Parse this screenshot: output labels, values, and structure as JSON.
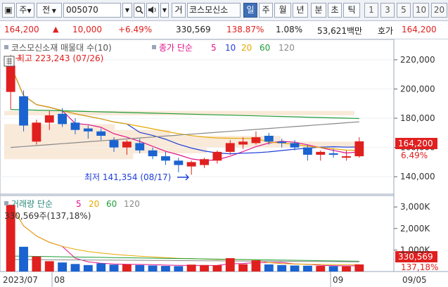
{
  "toolbar": {
    "type_label": "주",
    "mode_label": "전",
    "stock_code": "005070",
    "search_icon": "search-icon",
    "speaker_icon": "speaker-icon",
    "market_button": "거",
    "stock_name": "코스모신소",
    "periods": [
      "일",
      "주",
      "월",
      "년",
      "분",
      "초",
      "틱"
    ],
    "active_period": "일",
    "intervals": [
      "1",
      "3",
      "5",
      "10",
      "20"
    ]
  },
  "quote": {
    "price": "164,200",
    "arrow": "▲",
    "change": "10,000",
    "change_pct": "+6.49%",
    "volume": "330,569",
    "volume_ratio": "138.87%",
    "turnover": "1.08%",
    "amount": "53,621백만",
    "ask_label": "호가",
    "ask_price": "164,200"
  },
  "price_chart": {
    "title": "코스모신소재 매물대 수(10)",
    "ma_label": "종가 단순",
    "ma_periods": [
      "5",
      "10",
      "20",
      "60",
      "120"
    ],
    "high_label": "최고 223,243 (07/26)",
    "low_label": "최저 141,354 (08/17)",
    "y_ticks": [
      "220,000",
      "200,000",
      "180,000",
      "160,000",
      "140,000"
    ],
    "last_price": "164,200",
    "last_pct": "6.49%"
  },
  "volume_chart": {
    "title": "거래량 단순",
    "ma_periods": [
      "5",
      "20",
      "60",
      "120"
    ],
    "last_label": "330,569주(137,18%)",
    "y_ticks": [
      "3,000K",
      "2,000K",
      "1,000K"
    ],
    "last_volume": "330,569",
    "last_pct": "137,18%"
  },
  "x_axis": {
    "labels": [
      "2023/07",
      "08",
      "09",
      "09/05"
    ]
  },
  "colors": {
    "up": "#e0201f",
    "down": "#1a63d0",
    "ma5": "#e0138c",
    "ma10": "#1f3fd8",
    "ma20": "#e6a800",
    "ma60": "#1f9d3a",
    "ma120": "#888888"
  },
  "chart_data": {
    "type": "candlestick",
    "dates_first": "2023/07",
    "dates_last": "09/05",
    "candles": [
      {
        "o": 198000,
        "h": 223243,
        "l": 186000,
        "c": 216000
      },
      {
        "o": 195000,
        "h": 199000,
        "l": 171000,
        "c": 175000
      },
      {
        "o": 164000,
        "h": 179000,
        "l": 162000,
        "c": 177000
      },
      {
        "o": 177000,
        "h": 185000,
        "l": 172000,
        "c": 182000
      },
      {
        "o": 183000,
        "h": 187000,
        "l": 174000,
        "c": 176000
      },
      {
        "o": 177000,
        "h": 180000,
        "l": 169000,
        "c": 172000
      },
      {
        "o": 173000,
        "h": 175000,
        "l": 166000,
        "c": 171000
      },
      {
        "o": 171000,
        "h": 173000,
        "l": 165000,
        "c": 168000
      },
      {
        "o": 165000,
        "h": 167000,
        "l": 157000,
        "c": 160000
      },
      {
        "o": 160000,
        "h": 165000,
        "l": 155000,
        "c": 164000
      },
      {
        "o": 163000,
        "h": 166000,
        "l": 156000,
        "c": 158000
      },
      {
        "o": 158000,
        "h": 160000,
        "l": 152000,
        "c": 154000
      },
      {
        "o": 154000,
        "h": 157000,
        "l": 148000,
        "c": 151000
      },
      {
        "o": 151000,
        "h": 153000,
        "l": 143000,
        "c": 148000
      },
      {
        "o": 147000,
        "h": 151000,
        "l": 141354,
        "c": 150000
      },
      {
        "o": 148000,
        "h": 153000,
        "l": 146000,
        "c": 152000
      },
      {
        "o": 151000,
        "h": 158000,
        "l": 149000,
        "c": 157000
      },
      {
        "o": 157000,
        "h": 165000,
        "l": 155000,
        "c": 163000
      },
      {
        "o": 162000,
        "h": 167000,
        "l": 159000,
        "c": 164000
      },
      {
        "o": 163000,
        "h": 171000,
        "l": 162000,
        "c": 167000
      },
      {
        "o": 168000,
        "h": 170000,
        "l": 162000,
        "c": 164000
      },
      {
        "o": 164000,
        "h": 166000,
        "l": 160000,
        "c": 163000
      },
      {
        "o": 163000,
        "h": 165000,
        "l": 158000,
        "c": 160000
      },
      {
        "o": 160000,
        "h": 162000,
        "l": 151000,
        "c": 155000
      },
      {
        "o": 155000,
        "h": 158000,
        "l": 151000,
        "c": 157000
      },
      {
        "o": 156000,
        "h": 159000,
        "l": 153000,
        "c": 155000
      },
      {
        "o": 153000,
        "h": 158000,
        "l": 151000,
        "c": 154000
      },
      {
        "o": 154000,
        "h": 167000,
        "l": 153000,
        "c": 164200
      }
    ],
    "volumes": [
      3100000,
      1150000,
      700000,
      480000,
      420000,
      350000,
      300000,
      380000,
      320000,
      330000,
      300000,
      280000,
      260000,
      250000,
      320000,
      300000,
      290000,
      620000,
      340000,
      520000,
      330000,
      300000,
      280000,
      270000,
      260000,
      250000,
      240000,
      330569
    ],
    "ylim": [
      130000,
      232000
    ],
    "volume_ylim": [
      0,
      3400000
    ]
  }
}
